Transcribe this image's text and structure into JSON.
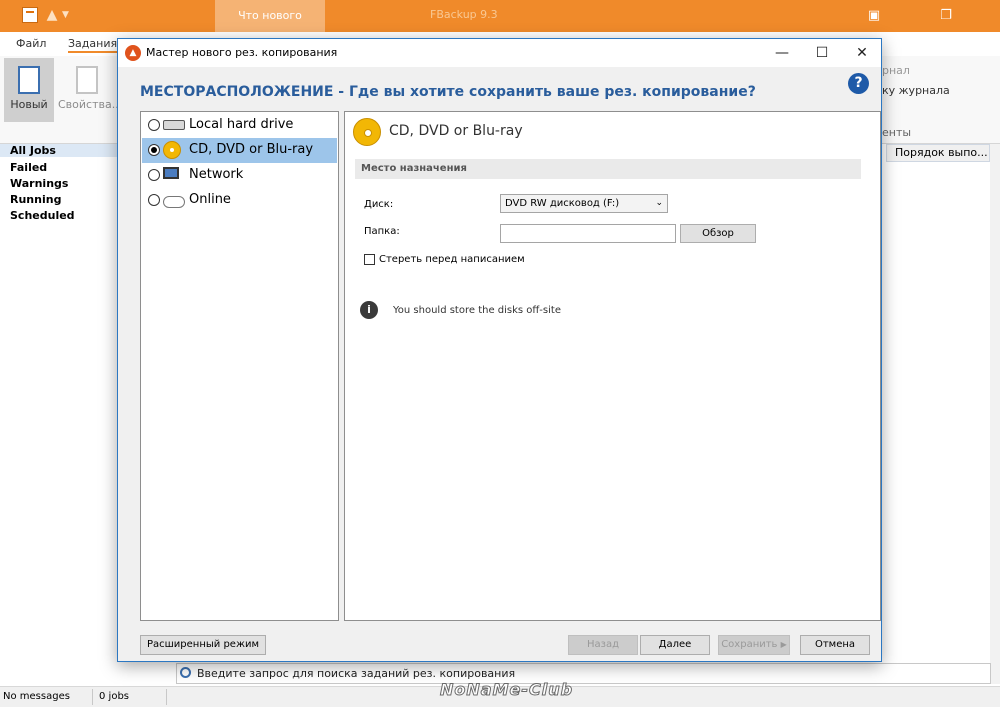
{
  "app": {
    "title": "FBackup 9.3",
    "whats_new_tab": "Что нового",
    "ribbon_tabs": [
      "Файл",
      "Задания"
    ],
    "ribbon_buttons": {
      "new_label": "Новый",
      "props_label": "Свойства..."
    },
    "ribbon_right": {
      "group_partial": "рнал",
      "log_partial": "ку журнала",
      "section_partial": "енты"
    },
    "nav_items": [
      "All Jobs",
      "Failed",
      "Warnings",
      "Running",
      "Scheduled"
    ],
    "column_header": "Порядок выпо...",
    "search_placeholder": "Введите запрос для поиска заданий рез. копирования",
    "status": {
      "messages": "No messages",
      "jobs": "0 jobs"
    },
    "watermark": "NoNaMe-Club"
  },
  "dialog": {
    "title": "Мастер нового рез. копирования",
    "heading": "МЕСТОРАСПОЛОЖЕНИЕ - Где вы хотите сохранить ваше рез. копирование?",
    "help_symbol": "?",
    "locations": [
      {
        "label": "Local hard drive",
        "icon": "hard-drive-icon",
        "selected": false
      },
      {
        "label": "CD, DVD or Blu-ray",
        "icon": "cd-icon",
        "selected": true
      },
      {
        "label": "Network",
        "icon": "network-icon",
        "selected": false
      },
      {
        "label": "Online",
        "icon": "cloud-icon",
        "selected": false
      }
    ],
    "detail": {
      "title": "CD, DVD or Blu-ray",
      "section": "Место назначения",
      "disk_label": "Диск:",
      "disk_value": "DVD RW дисковод (F:)",
      "folder_label": "Папка:",
      "folder_value": "",
      "browse_button": "Обзор",
      "erase_checkbox_label": "Стереть перед написанием",
      "erase_checked": false,
      "info_text": "You should store the disks off-site"
    },
    "footer": {
      "advanced_button": "Расширенный режим",
      "back_button": "Назад",
      "next_button": "Далее",
      "save_button": "Сохранить",
      "cancel_button": "Отмена"
    }
  },
  "colors": {
    "app_titlebar": "#f08a2a",
    "heading": "#2a5d9c",
    "selected_row": "#9dc5ea",
    "dialog_border": "#2b77c2"
  }
}
